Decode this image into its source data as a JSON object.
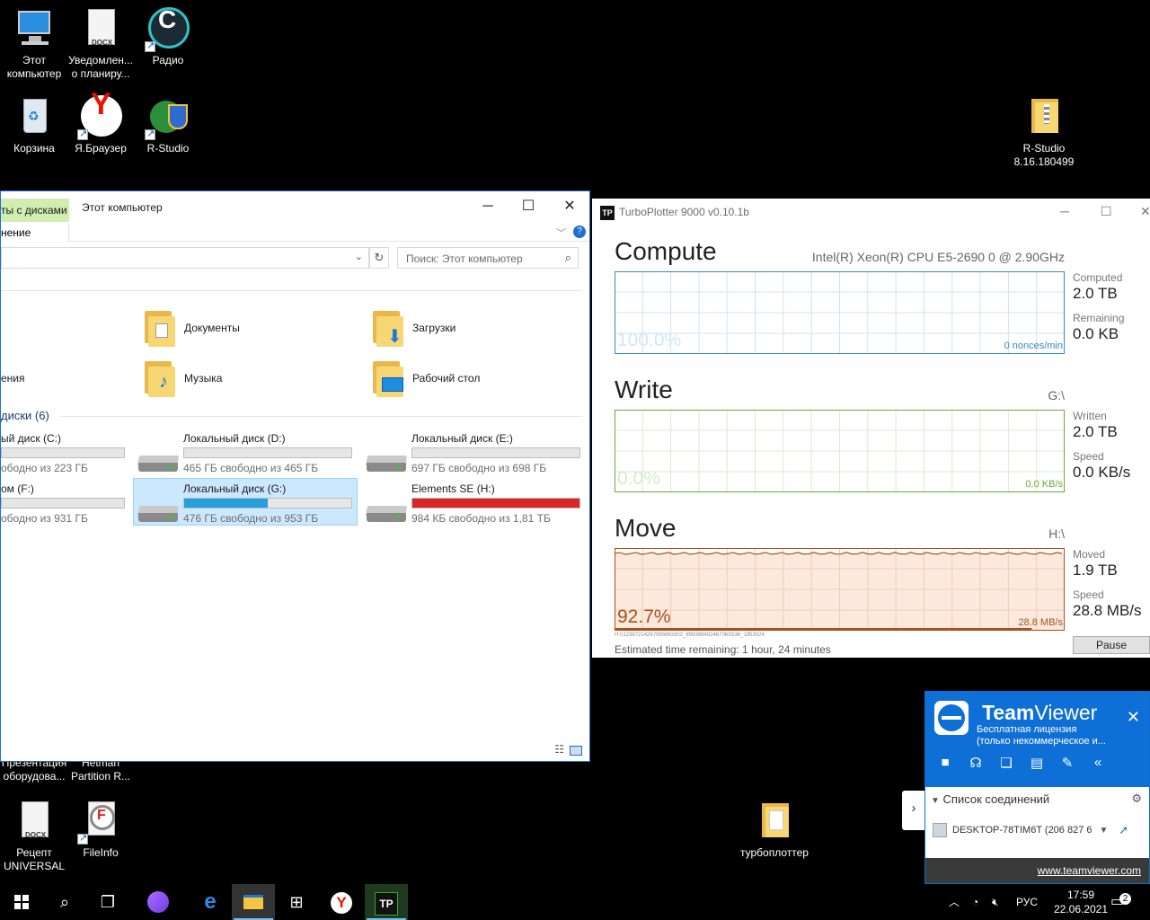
{
  "desktop_icons": [
    {
      "id": "this-pc",
      "label": "Этот компьютер",
      "x": 0
    },
    {
      "id": "docx-notice",
      "label": "Уведомлен... о планиру..."
    },
    {
      "id": "radio",
      "label": "Радио"
    },
    {
      "id": "recycle-bin",
      "label": "Корзина"
    },
    {
      "id": "yandex-browser",
      "label": "Я.Браузер"
    },
    {
      "id": "r-studio",
      "label": "R-Studio"
    },
    {
      "id": "r-studio-folder",
      "label": "R-Studio 8.16.180499"
    },
    {
      "id": "presentation",
      "label": "Презентация оборудова..."
    },
    {
      "id": "hetman",
      "label": "Hetman Partition R..."
    },
    {
      "id": "recept",
      "label": "Рецепт UNIVERSAL"
    },
    {
      "id": "fileinfo",
      "label": "FileInfo"
    },
    {
      "id": "turboplotter-folder",
      "label": "турбоплоттер"
    }
  ],
  "explorer": {
    "ribbon_tab": "ты с дисками",
    "sub_tab": "нение",
    "title": "Этот компьютер",
    "search_placeholder": "Поиск: Этот компьютер",
    "folders": [
      {
        "name": "Документы"
      },
      {
        "name": "Загрузки"
      },
      {
        "name": "ения"
      },
      {
        "name": "Музыка"
      },
      {
        "name": "Рабочий стол"
      }
    ],
    "drives_section": "диски (6)",
    "drives": [
      {
        "name": "ый диск (C:)",
        "free": "ободно из 223 ГБ",
        "used_fraction": 0.0,
        "color": "#26a0da"
      },
      {
        "name": "Локальный диск (D:)",
        "free": "465 ГБ свободно из 465 ГБ",
        "used_fraction": 0.0,
        "color": "#26a0da"
      },
      {
        "name": "Локальный диск (E:)",
        "free": "697 ГБ свободно из 698 ГБ",
        "used_fraction": 0.0,
        "color": "#26a0da"
      },
      {
        "name": "ом (F:)",
        "free": "ободно из 931 ГБ",
        "used_fraction": 0.0,
        "color": "#26a0da"
      },
      {
        "name": "Локальный диск (G:)",
        "free": "476 ГБ свободно из 953 ГБ",
        "used_fraction": 0.5,
        "color": "#26a0da"
      },
      {
        "name": "Elements SE (H:)",
        "free": "984 КБ свободно из 1,81 ТБ",
        "used_fraction": 1.0,
        "color": "#da2626"
      }
    ]
  },
  "turbo": {
    "title": "TurboPlotter 9000 v0.10.1b",
    "logo": "TP",
    "compute": {
      "title": "Compute",
      "cpu": "Intel(R) Xeon(R) CPU E5-2690 0 @ 2.90GHz",
      "percent": "100.0%",
      "rate": "0 nonces/min",
      "stat1_label": "Computed",
      "stat1_value": "2.0 TB",
      "stat2_label": "Remaining",
      "stat2_value": "0.0 KB",
      "color": "#3a86c8"
    },
    "write": {
      "title": "Write",
      "drive": "G:\\",
      "percent": "0.0%",
      "rate": "0.0 KB/s",
      "stat1_label": "Written",
      "stat1_value": "2.0 TB",
      "stat2_label": "Speed",
      "stat2_value": "0.0 KB/s",
      "color": "#6aaa3a"
    },
    "move": {
      "title": "Move",
      "drive": "H:\\",
      "percent": "92.7%",
      "rate": "28.8 MB/s",
      "stat1_label": "Moved",
      "stat1_value": "1.9 TB",
      "stat2_label": "Speed",
      "stat2_value": "28.8 MB/s",
      "color": "#a6521a",
      "progress_fraction": 0.927
    },
    "path": "H:\\\\12387214297085963302_89938648246706S536_1953024",
    "eta": "Estimated time remaining: 1 hour, 24 minutes",
    "pause_label": "Pause"
  },
  "teamviewer": {
    "name_bold": "Team",
    "name_rest": "Viewer",
    "license_line1": "Бесплатная лицензия",
    "license_line2": "(только некоммерческое и...",
    "list_title": "Список соединений",
    "device": "DESKTOP-78TIM6T (206 827 6",
    "url": "www.teamviewer.com"
  },
  "taskbar": {
    "lang": "РУС",
    "time": "17:59",
    "date": "22.06.2021",
    "notifications": "2"
  }
}
